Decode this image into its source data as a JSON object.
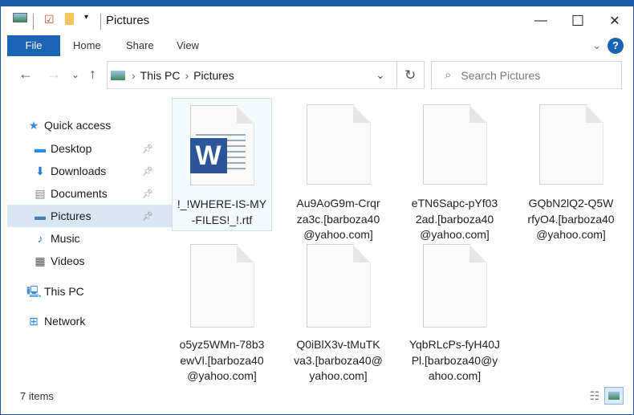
{
  "window": {
    "title": "Pictures",
    "minimize": "—",
    "maximize": "☐",
    "close": "✕"
  },
  "ribbon": {
    "tabs": [
      "File",
      "Home",
      "Share",
      "View"
    ],
    "help": "?"
  },
  "address": {
    "crumbs": [
      "This PC",
      "Pictures"
    ],
    "search_placeholder": "Search Pictures"
  },
  "sidebar": {
    "items": [
      {
        "label": "Quick access",
        "icon": "star-icon",
        "glyph": "★",
        "color": "#3b8ad9"
      },
      {
        "label": "Desktop",
        "icon": "desktop-icon",
        "glyph": "▬",
        "color": "#2b8ce6",
        "pinned": true
      },
      {
        "label": "Downloads",
        "icon": "download-icon",
        "glyph": "⬇",
        "color": "#2a7ad3",
        "pinned": true
      },
      {
        "label": "Documents",
        "icon": "documents-icon",
        "glyph": "▤",
        "color": "#888",
        "pinned": true
      },
      {
        "label": "Pictures",
        "icon": "pictures-icon",
        "glyph": "▬",
        "color": "#4a7fb0",
        "pinned": true,
        "selected": true
      },
      {
        "label": "Music",
        "icon": "music-icon",
        "glyph": "♪",
        "color": "#2a7ad3"
      },
      {
        "label": "Videos",
        "icon": "videos-icon",
        "glyph": "▦",
        "color": "#555"
      },
      {
        "label": "This PC",
        "icon": "computer-icon",
        "glyph": "🖳",
        "color": "#3b8ad9"
      },
      {
        "label": "Network",
        "icon": "network-icon",
        "glyph": "⊞",
        "color": "#3b8ad9"
      }
    ]
  },
  "files": [
    {
      "name": "!_!WHERE-IS-MY-FILES!_!.rtf",
      "lines": [
        "!_!WHERE-IS-MY",
        "-FILES!_!.rtf"
      ],
      "type": "word"
    },
    {
      "name": "Au9AoG9m-Crqrza3c.[barboza40@yahoo.com]",
      "lines": [
        "Au9AoG9m-Crqr",
        "za3c.[barboza40",
        "@yahoo.com]"
      ]
    },
    {
      "name": "eTN6Sapc-pYf032ad.[barboza40@yahoo.com]",
      "lines": [
        "eTN6Sapc-pYf03",
        "2ad.[barboza40",
        "@yahoo.com]"
      ]
    },
    {
      "name": "GQbN2lQ2-Q5WrfyO4.[barboza40@yahoo.com]",
      "lines": [
        "GQbN2lQ2-Q5W",
        "rfyO4.[barboza40",
        "@yahoo.com]"
      ]
    },
    {
      "name": "o5yz5WMn-78b3ewVl.[barboza40@yahoo.com]",
      "lines": [
        "o5yz5WMn-78b3",
        "ewVl.[barboza40",
        "@yahoo.com]"
      ]
    },
    {
      "name": "Q0iBlX3v-tMuTKva3.[barboza40@yahoo.com]",
      "lines": [
        "Q0iBlX3v-tMuTK",
        "va3.[barboza40@",
        "yahoo.com]"
      ]
    },
    {
      "name": "YqbRLcPs-fyH40JPl.[barboza40@yahoo.com]",
      "lines": [
        "YqbRLcPs-fyH40J",
        "Pl.[barboza40@y",
        "ahoo.com]"
      ]
    }
  ],
  "status": {
    "count": "7 items"
  }
}
